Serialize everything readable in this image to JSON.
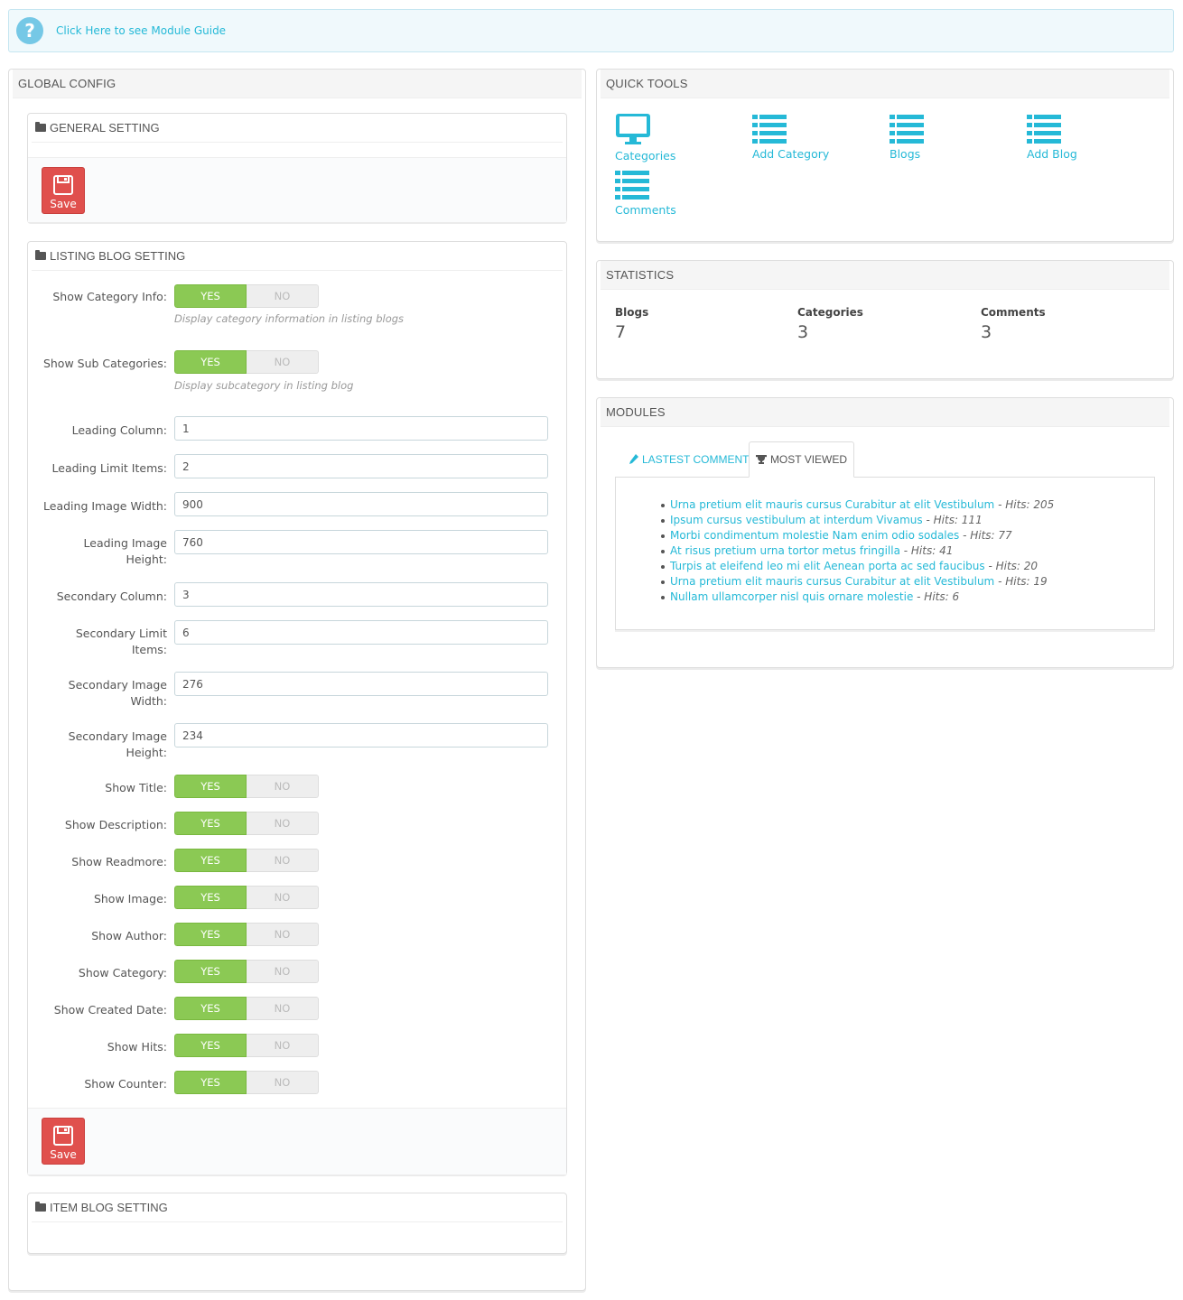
{
  "guide": {
    "link": "Click Here to see Module Guide"
  },
  "global_config": {
    "title": "GLOBAL CONFIG",
    "general": {
      "title": "GENERAL SETTING",
      "save_label": "Save"
    },
    "listing": {
      "title": "LISTING BLOG SETTING",
      "save_label": "Save",
      "yes": "YES",
      "no": "NO",
      "show_category_info": {
        "label": "Show Category Info:",
        "help": "Display category information in listing blogs"
      },
      "show_sub_categories": {
        "label": "Show Sub Categories:",
        "help": "Display subcategory in listing blog"
      },
      "leading_column": {
        "label": "Leading Column:",
        "value": "1"
      },
      "leading_limit": {
        "label": "Leading Limit Items:",
        "value": "2"
      },
      "leading_width": {
        "label": "Leading Image Width:",
        "value": "900"
      },
      "leading_height": {
        "label": "Leading Image Height:",
        "value": "760"
      },
      "secondary_column": {
        "label": "Secondary Column:",
        "value": "3"
      },
      "secondary_limit": {
        "label": "Secondary Limit Items:",
        "value": "6"
      },
      "secondary_width": {
        "label": "Secondary Image Width:",
        "value": "276"
      },
      "secondary_height": {
        "label": "Secondary Image Height:",
        "value": "234"
      },
      "toggles": [
        "Show Title:",
        "Show Description:",
        "Show Readmore:",
        "Show Image:",
        "Show Author:",
        "Show Category:",
        "Show Created Date:",
        "Show Hits:",
        "Show Counter:"
      ]
    },
    "item": {
      "title": "ITEM BLOG SETTING"
    }
  },
  "quick_tools": {
    "title": "QUICK TOOLS",
    "items": [
      "Categories",
      "Add Category",
      "Blogs",
      "Add Blog",
      "Comments"
    ],
    "color": "#25b9d7"
  },
  "statistics": {
    "title": "STATISTICS",
    "items": [
      {
        "label": "Blogs",
        "value": "7"
      },
      {
        "label": "Categories",
        "value": "3"
      },
      {
        "label": "Comments",
        "value": "3"
      }
    ]
  },
  "modules": {
    "title": "MODULES",
    "tab_latest": "LASTEST COMMENTS",
    "tab_most_viewed": "MOST VIEWED",
    "most_viewed": [
      {
        "title": "Urna pretium elit mauris cursus Curabitur at elit Vestibulum",
        "hits": "- Hits: 205"
      },
      {
        "title": "Ipsum cursus vestibulum at interdum Vivamus",
        "hits": "- Hits: 111"
      },
      {
        "title": "Morbi condimentum molestie Nam enim odio sodales",
        "hits": "- Hits: 77"
      },
      {
        "title": "At risus pretium urna tortor metus fringilla",
        "hits": "- Hits: 41"
      },
      {
        "title": "Turpis at eleifend leo mi elit Aenean porta ac sed faucibus",
        "hits": "- Hits: 20"
      },
      {
        "title": "Urna pretium elit mauris cursus Curabitur at elit Vestibulum",
        "hits": "- Hits: 19"
      },
      {
        "title": "Nullam ullamcorper nisl quis ornare molestie",
        "hits": "- Hits: 6"
      }
    ]
  }
}
